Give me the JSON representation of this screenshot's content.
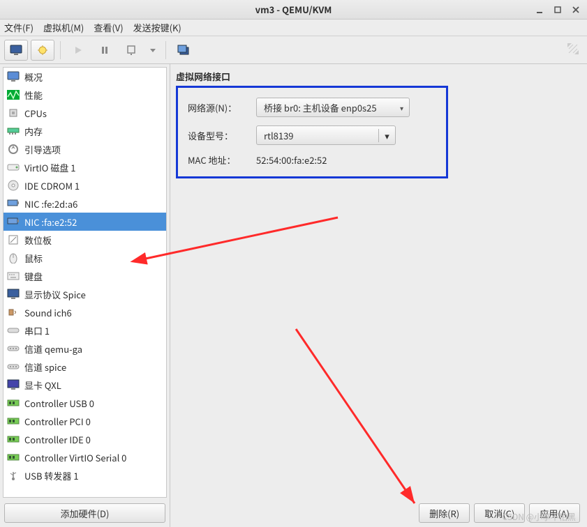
{
  "window": {
    "title": "vm3 - QEMU/KVM"
  },
  "menu": {
    "file": "文件(F)",
    "vm": "虚拟机(M)",
    "view": "查看(V)",
    "sendkey": "发送按键(K)"
  },
  "toolbar": {
    "monitor": "monitor",
    "bulb": "bulb",
    "play": "play",
    "pause": "pause",
    "shutdown": "shutdown",
    "dropdown": "dropdown",
    "fullscreen": "fullscreen",
    "expand": "expand"
  },
  "sidebar": {
    "items": [
      {
        "label": "概况",
        "icon": "monitor-icon"
      },
      {
        "label": "性能",
        "icon": "activity-icon"
      },
      {
        "label": "CPUs",
        "icon": "cpu-icon"
      },
      {
        "label": "内存",
        "icon": "memory-icon"
      },
      {
        "label": "引导选项",
        "icon": "boot-icon"
      },
      {
        "label": "VirtIO 磁盘 1",
        "icon": "disk-icon"
      },
      {
        "label": "IDE CDROM 1",
        "icon": "cdrom-icon"
      },
      {
        "label": "NIC :fe:2d:a6",
        "icon": "nic-icon"
      },
      {
        "label": "NIC :fa:e2:52",
        "icon": "nic-icon",
        "selected": true
      },
      {
        "label": "数位板",
        "icon": "tablet-icon"
      },
      {
        "label": "鼠标",
        "icon": "mouse-icon"
      },
      {
        "label": "键盘",
        "icon": "keyboard-icon"
      },
      {
        "label": "显示协议 Spice",
        "icon": "display-icon"
      },
      {
        "label": "Sound ich6",
        "icon": "sound-icon"
      },
      {
        "label": "串口 1",
        "icon": "serial-icon"
      },
      {
        "label": "信道 qemu-ga",
        "icon": "channel-icon"
      },
      {
        "label": "信道 spice",
        "icon": "channel-icon"
      },
      {
        "label": "显卡 QXL",
        "icon": "video-icon"
      },
      {
        "label": "Controller USB 0",
        "icon": "controller-icon"
      },
      {
        "label": "Controller PCI 0",
        "icon": "controller-icon"
      },
      {
        "label": "Controller IDE 0",
        "icon": "controller-icon"
      },
      {
        "label": "Controller VirtIO Serial 0",
        "icon": "controller-icon"
      },
      {
        "label": "USB 转发器 1",
        "icon": "usb-icon"
      }
    ],
    "add_hardware": "添加硬件(D)"
  },
  "panel": {
    "title": "虚拟网络接口",
    "netsource_label": "网络源(N)：",
    "netsource_value": "桥接 br0: 主机设备 enp0s25",
    "device_model_label": "设备型号：",
    "device_model_value": "rtl8139",
    "mac_label": "MAC 地址：",
    "mac_value": "52:54:00:fa:e2:52"
  },
  "actions": {
    "delete": "删除(R)",
    "cancel": "取消(C)",
    "apply": "应用(A)"
  },
  "watermark": "CSDN @小李不怕黑"
}
